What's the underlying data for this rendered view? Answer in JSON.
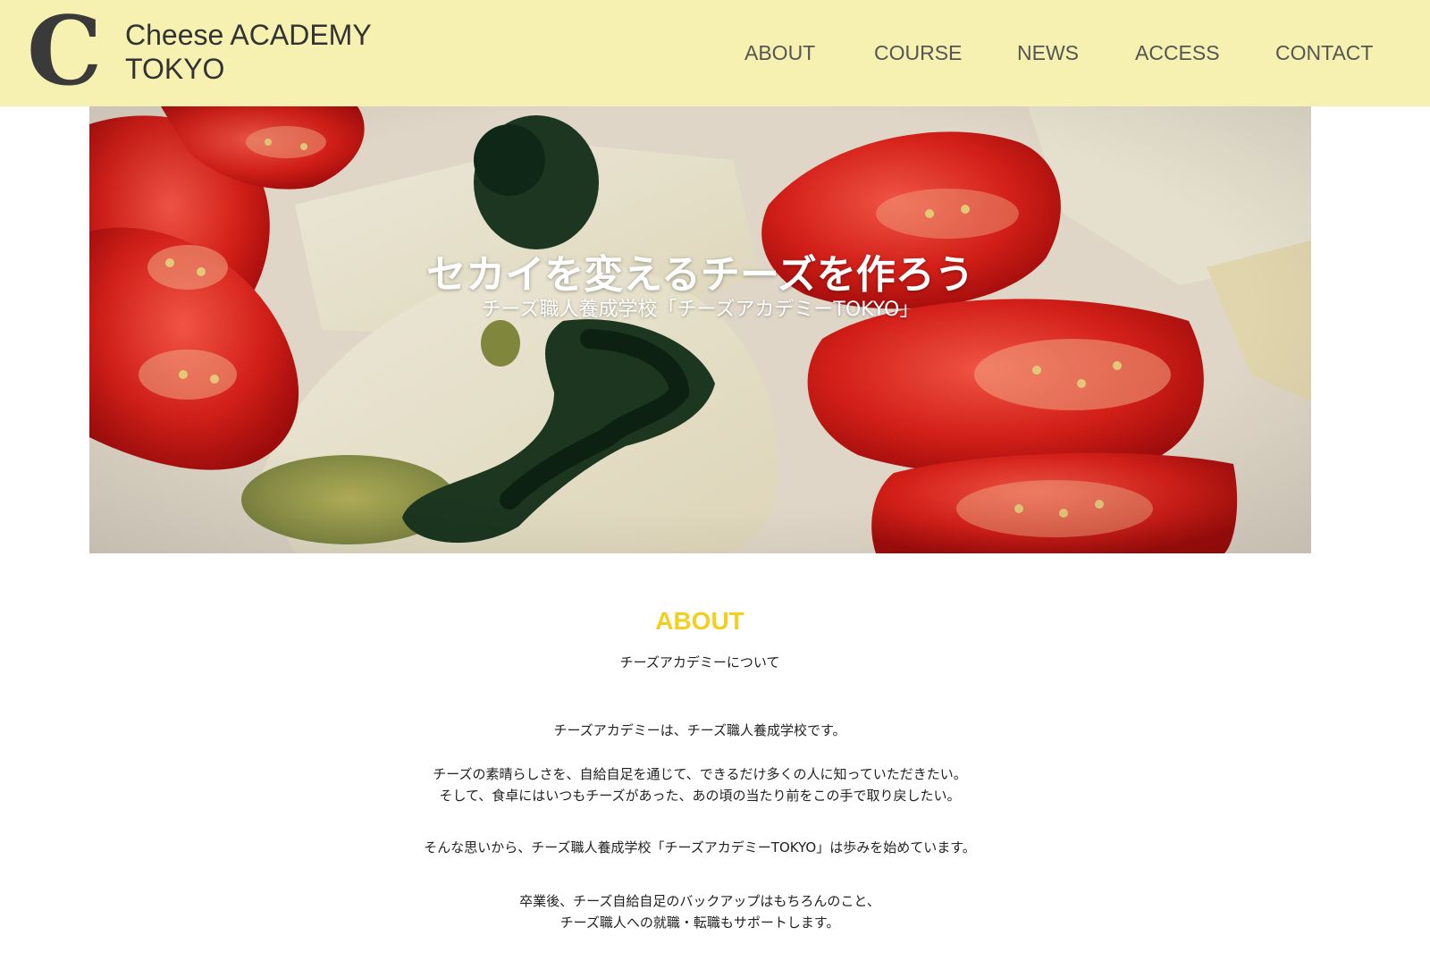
{
  "header": {
    "logo_letter": "C",
    "logo_line1": "Cheese ACADEMY",
    "logo_line2": "TOKYO",
    "background": "#f6f1b0"
  },
  "nav": {
    "items": [
      {
        "label": "ABOUT"
      },
      {
        "label": "COURSE"
      },
      {
        "label": "NEWS"
      },
      {
        "label": "ACCESS"
      },
      {
        "label": "CONTACT"
      }
    ]
  },
  "hero": {
    "title": "セカイを変えるチーズを作ろう",
    "subtitle": "チーズ職人養成学校「チーズアカデミーTOKYO」",
    "image": "cheese-and-tomato-photo"
  },
  "about": {
    "heading": "ABOUT",
    "heading_color": "#f5cf1f",
    "subheading": "チーズアカデミーについて",
    "paragraphs": [
      {
        "lines": [
          "チーズアカデミーは、チーズ職人養成学校です。"
        ]
      },
      {
        "lines": [
          "チーズの素晴らしさを、自給自足を通じて、できるだけ多くの人に知っていただきたい。",
          "そして、食卓にはいつもチーズがあった、あの頃の当たり前をこの手で取り戻したい。"
        ]
      },
      {
        "lines": [
          "そんな思いから、チーズ職人養成学校「チーズアカデミーTOKYO」は歩みを始めています。"
        ]
      },
      {
        "lines": [
          "卒業後、チーズ自給自足のバックアップはもちろんのこと、",
          "チーズ職人への就職・転職もサポートします。"
        ]
      }
    ]
  }
}
